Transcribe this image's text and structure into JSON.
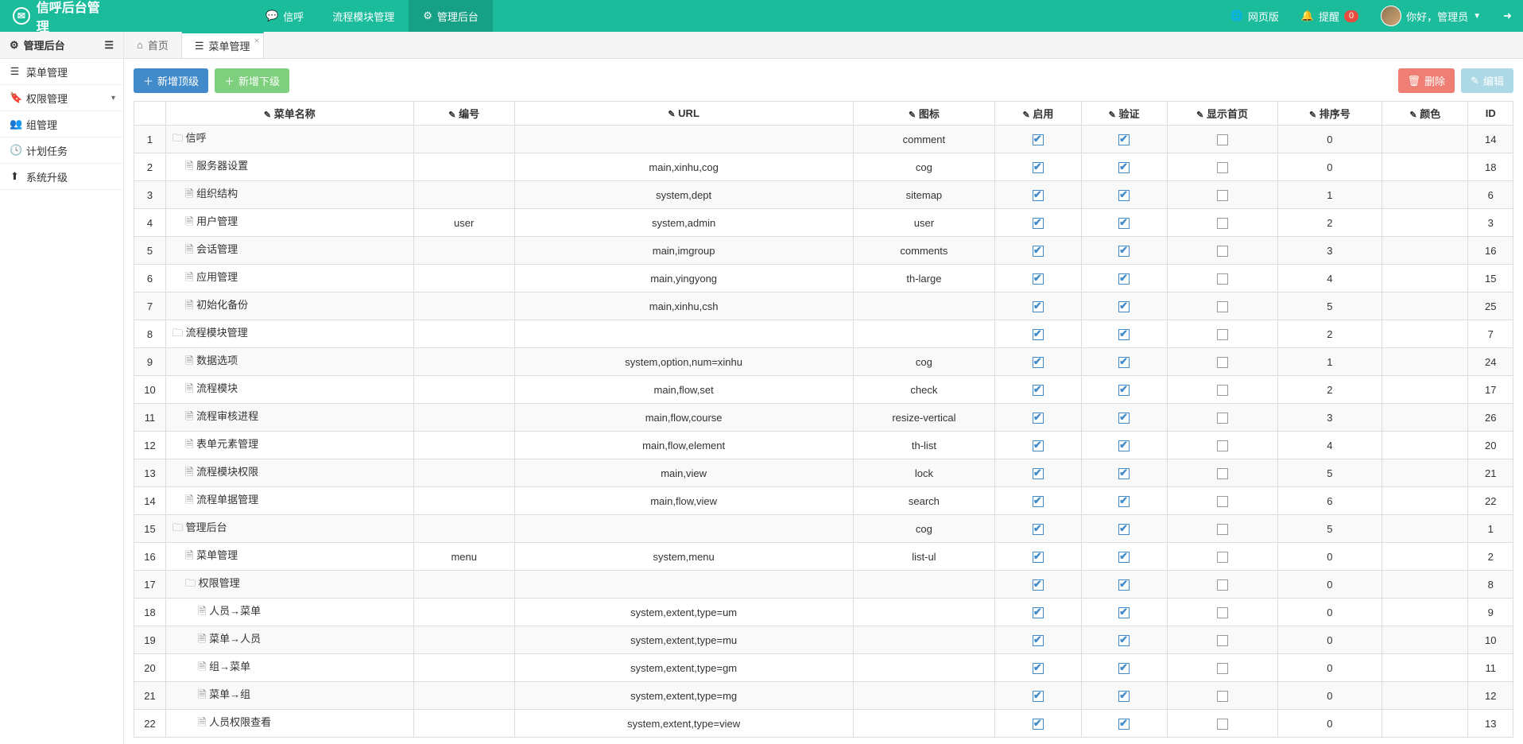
{
  "brand": "信呼后台管理",
  "topnav": [
    {
      "icon": "💬",
      "label": "信呼",
      "active": false
    },
    {
      "icon": "",
      "label": "流程模块管理",
      "active": false
    },
    {
      "icon": "⚙",
      "label": "管理后台",
      "active": true
    }
  ],
  "topright": {
    "web": "网页版",
    "remind": "提醒",
    "remind_count": "0",
    "greet": "你好，管理员"
  },
  "sidebar": {
    "header": "管理后台",
    "items": [
      {
        "icon": "☰",
        "label": "菜单管理",
        "caret": false
      },
      {
        "icon": "🔖",
        "label": "权限管理",
        "caret": true
      },
      {
        "icon": "👥",
        "label": "组管理",
        "caret": false
      },
      {
        "icon": "🕓",
        "label": "计划任务",
        "caret": false
      },
      {
        "icon": "⬆",
        "label": "系统升级",
        "caret": false
      }
    ]
  },
  "tabs": [
    {
      "icon": "⌂",
      "label": "首页",
      "active": false,
      "closable": false
    },
    {
      "icon": "☰",
      "label": "菜单管理",
      "active": true,
      "closable": true
    }
  ],
  "toolbar": {
    "add_top": "新增顶级",
    "add_sub": "新增下级",
    "delete": "删除",
    "edit": "编辑"
  },
  "columns": [
    "",
    "菜单名称",
    "编号",
    "URL",
    "图标",
    "启用",
    "验证",
    "显示首页",
    "排序号",
    "颜色",
    "ID"
  ],
  "rows": [
    {
      "n": 1,
      "indent": 0,
      "folder": true,
      "name": "信呼",
      "code": "",
      "url": "",
      "icon": "comment",
      "en": true,
      "ve": true,
      "hp": false,
      "sort": "0",
      "color": "",
      "id": 14
    },
    {
      "n": 2,
      "indent": 1,
      "folder": false,
      "name": "服务器设置",
      "code": "",
      "url": "main,xinhu,cog",
      "icon": "cog",
      "en": true,
      "ve": true,
      "hp": false,
      "sort": "0",
      "color": "",
      "id": 18
    },
    {
      "n": 3,
      "indent": 1,
      "folder": false,
      "name": "组织结构",
      "code": "",
      "url": "system,dept",
      "icon": "sitemap",
      "en": true,
      "ve": true,
      "hp": false,
      "sort": "1",
      "color": "",
      "id": 6
    },
    {
      "n": 4,
      "indent": 1,
      "folder": false,
      "name": "用户管理",
      "code": "user",
      "url": "system,admin",
      "icon": "user",
      "en": true,
      "ve": true,
      "hp": false,
      "sort": "2",
      "color": "",
      "id": 3
    },
    {
      "n": 5,
      "indent": 1,
      "folder": false,
      "name": "会话管理",
      "code": "",
      "url": "main,imgroup",
      "icon": "comments",
      "en": true,
      "ve": true,
      "hp": false,
      "sort": "3",
      "color": "",
      "id": 16
    },
    {
      "n": 6,
      "indent": 1,
      "folder": false,
      "name": "应用管理",
      "code": "",
      "url": "main,yingyong",
      "icon": "th-large",
      "en": true,
      "ve": true,
      "hp": false,
      "sort": "4",
      "color": "",
      "id": 15
    },
    {
      "n": 7,
      "indent": 1,
      "folder": false,
      "name": "初始化备份",
      "code": "",
      "url": "main,xinhu,csh",
      "icon": "",
      "en": true,
      "ve": true,
      "hp": false,
      "sort": "5",
      "color": "",
      "id": 25
    },
    {
      "n": 8,
      "indent": 0,
      "folder": true,
      "name": "流程模块管理",
      "code": "",
      "url": "",
      "icon": "",
      "en": true,
      "ve": true,
      "hp": false,
      "sort": "2",
      "color": "",
      "id": 7
    },
    {
      "n": 9,
      "indent": 1,
      "folder": false,
      "name": "数据选项",
      "code": "",
      "url": "system,option,num=xinhu",
      "icon": "cog",
      "en": true,
      "ve": true,
      "hp": false,
      "sort": "1",
      "color": "",
      "id": 24
    },
    {
      "n": 10,
      "indent": 1,
      "folder": false,
      "name": "流程模块",
      "code": "",
      "url": "main,flow,set",
      "icon": "check",
      "en": true,
      "ve": true,
      "hp": false,
      "sort": "2",
      "color": "",
      "id": 17
    },
    {
      "n": 11,
      "indent": 1,
      "folder": false,
      "name": "流程审核进程",
      "code": "",
      "url": "main,flow,course",
      "icon": "resize-vertical",
      "en": true,
      "ve": true,
      "hp": false,
      "sort": "3",
      "color": "",
      "id": 26
    },
    {
      "n": 12,
      "indent": 1,
      "folder": false,
      "name": "表单元素管理",
      "code": "",
      "url": "main,flow,element",
      "icon": "th-list",
      "en": true,
      "ve": true,
      "hp": false,
      "sort": "4",
      "color": "",
      "id": 20
    },
    {
      "n": 13,
      "indent": 1,
      "folder": false,
      "name": "流程模块权限",
      "code": "",
      "url": "main,view",
      "icon": "lock",
      "en": true,
      "ve": true,
      "hp": false,
      "sort": "5",
      "color": "",
      "id": 21
    },
    {
      "n": 14,
      "indent": 1,
      "folder": false,
      "name": "流程单据管理",
      "code": "",
      "url": "main,flow,view",
      "icon": "search",
      "en": true,
      "ve": true,
      "hp": false,
      "sort": "6",
      "color": "",
      "id": 22
    },
    {
      "n": 15,
      "indent": 0,
      "folder": true,
      "name": "管理后台",
      "code": "",
      "url": "",
      "icon": "cog",
      "en": true,
      "ve": true,
      "hp": false,
      "sort": "5",
      "color": "",
      "id": 1
    },
    {
      "n": 16,
      "indent": 1,
      "folder": false,
      "name": "菜单管理",
      "code": "menu",
      "url": "system,menu",
      "icon": "list-ul",
      "en": true,
      "ve": true,
      "hp": false,
      "sort": "0",
      "color": "",
      "id": 2
    },
    {
      "n": 17,
      "indent": 1,
      "folder": true,
      "name": "权限管理",
      "code": "",
      "url": "",
      "icon": "",
      "en": true,
      "ve": true,
      "hp": false,
      "sort": "0",
      "color": "",
      "id": 8
    },
    {
      "n": 18,
      "indent": 2,
      "folder": false,
      "name": "人员→菜单",
      "code": "",
      "url": "system,extent,type=um",
      "icon": "",
      "en": true,
      "ve": true,
      "hp": false,
      "sort": "0",
      "color": "",
      "id": 9
    },
    {
      "n": 19,
      "indent": 2,
      "folder": false,
      "name": "菜单→人员",
      "code": "",
      "url": "system,extent,type=mu",
      "icon": "",
      "en": true,
      "ve": true,
      "hp": false,
      "sort": "0",
      "color": "",
      "id": 10
    },
    {
      "n": 20,
      "indent": 2,
      "folder": false,
      "name": "组→菜单",
      "code": "",
      "url": "system,extent,type=gm",
      "icon": "",
      "en": true,
      "ve": true,
      "hp": false,
      "sort": "0",
      "color": "",
      "id": 11
    },
    {
      "n": 21,
      "indent": 2,
      "folder": false,
      "name": "菜单→组",
      "code": "",
      "url": "system,extent,type=mg",
      "icon": "",
      "en": true,
      "ve": true,
      "hp": false,
      "sort": "0",
      "color": "",
      "id": 12
    },
    {
      "n": 22,
      "indent": 2,
      "folder": false,
      "name": "人员权限查看",
      "code": "",
      "url": "system,extent,type=view",
      "icon": "",
      "en": true,
      "ve": true,
      "hp": false,
      "sort": "0",
      "color": "",
      "id": 13
    }
  ]
}
